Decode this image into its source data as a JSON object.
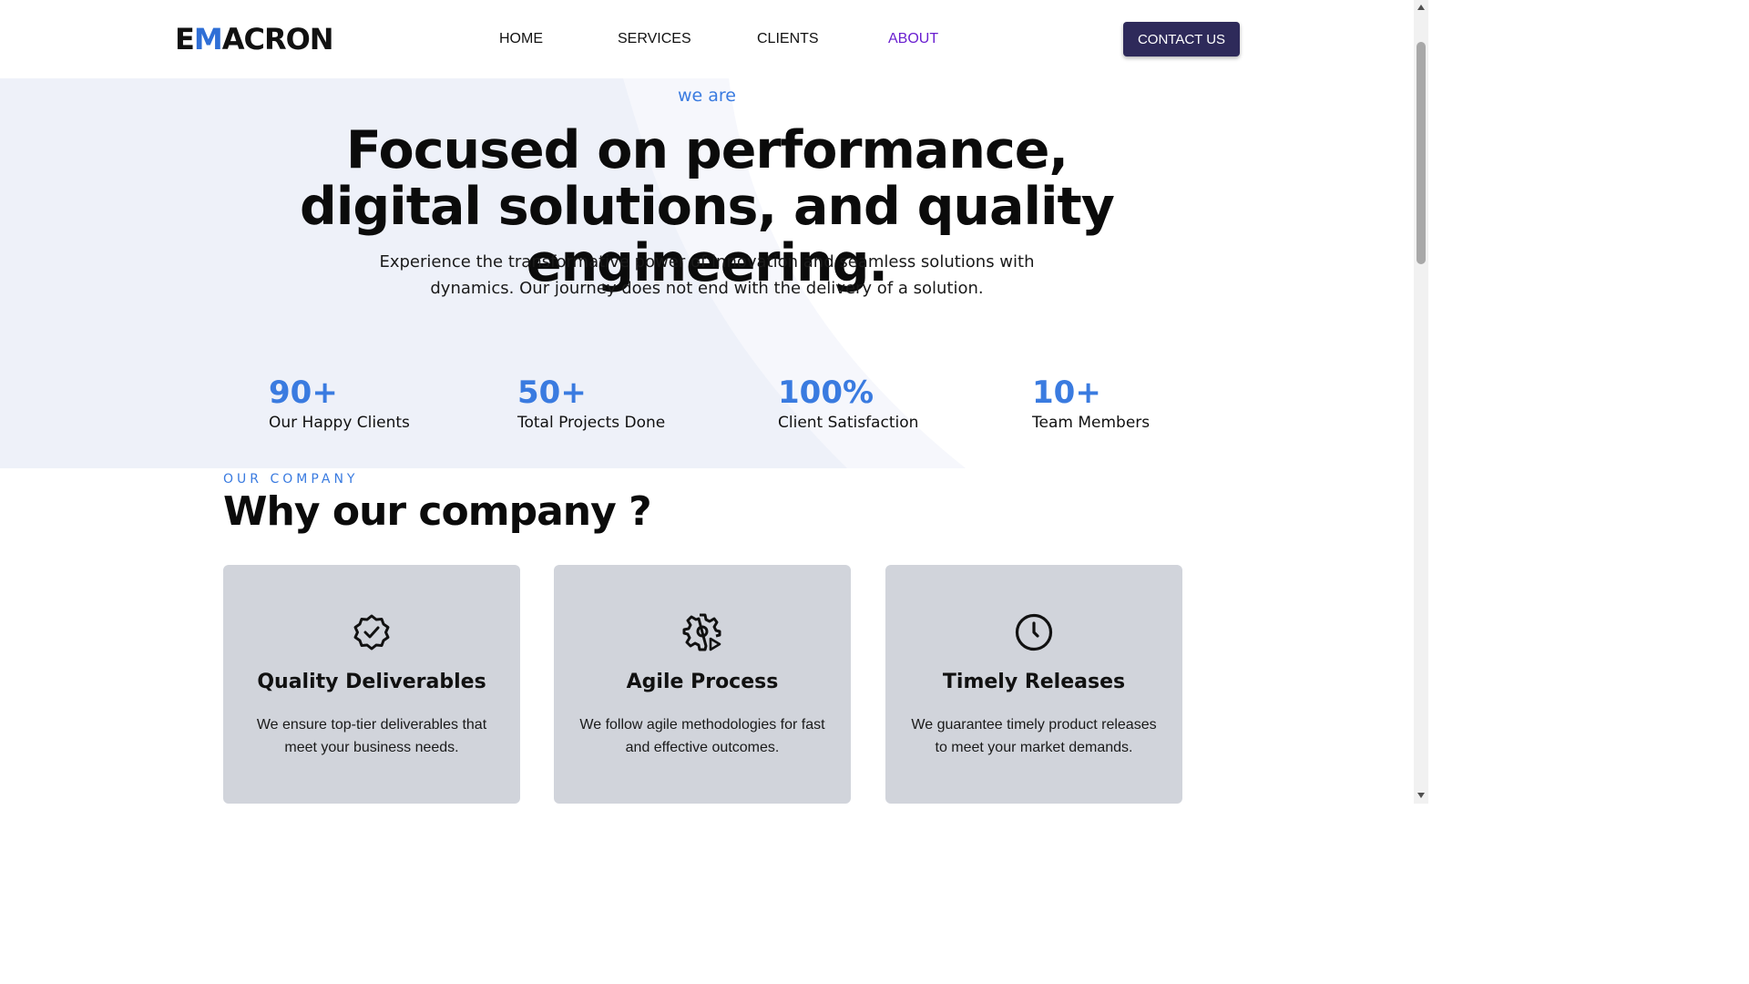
{
  "header": {
    "logo_first": "E",
    "logo_accent": "M",
    "logo_rest": "ACRON",
    "nav": [
      {
        "label": "HOME"
      },
      {
        "label": "SERVICES"
      },
      {
        "label": "CLIENTS"
      },
      {
        "label": "ABOUT",
        "active": true
      }
    ],
    "contact_label": "CONTACT US"
  },
  "hero": {
    "eyebrow": "we are",
    "title": "Focused on performance, digital solutions, and quality engineering.",
    "subtitle": "Experience the transformative power of innovation and seamless solutions with dynamics. Our journey does not end with the delivery of a solution."
  },
  "stats": [
    {
      "value": "90+",
      "label": "Our Happy Clients"
    },
    {
      "value": "50+",
      "label": "Total Projects Done"
    },
    {
      "value": "100%",
      "label": "Client Satisfaction"
    },
    {
      "value": "10+",
      "label": "Team Members"
    }
  ],
  "company": {
    "eyebrow": "OUR COMPANY",
    "title": "Why our company ?",
    "cards": [
      {
        "icon": "badge-check-icon",
        "title": "Quality Deliverables",
        "description": "We ensure top-tier deliverables that meet your business needs."
      },
      {
        "icon": "gear-play-icon",
        "title": "Agile Process",
        "description": "We follow agile methodologies for fast and effective outcomes."
      },
      {
        "icon": "clock-icon",
        "title": "Timely Releases",
        "description": "We guarantee timely product releases to meet your market demands."
      }
    ]
  },
  "colors": {
    "accent": "#3a7be0",
    "nav_active": "#6a1fd0",
    "contact_button": "#2e2a5a",
    "hero_background": "#eef1f9",
    "card_background": "#d1d4db"
  }
}
